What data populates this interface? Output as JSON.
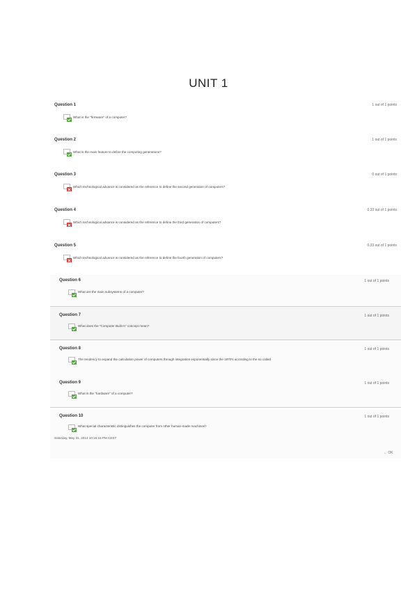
{
  "page": {
    "title": "UNIT 1"
  },
  "questions": [
    {
      "heading": "Question 1",
      "points": "1 out of 1 points",
      "status": "correct",
      "text": "What is the \"firmware\" of a computer?"
    },
    {
      "heading": "Question 2",
      "points": "1 out of 1 points",
      "status": "correct",
      "text": "What is the main feature to define the computing generations?"
    },
    {
      "heading": "Question 3",
      "points": "0 out of 1 points",
      "status": "incorrect",
      "text": "Which technological advance is considered as the reference to define the second generation of computers?"
    },
    {
      "heading": "Question 4",
      "points": "0.33 out of 1 points",
      "status": "incorrect",
      "text": "Which technological advance is considered as the reference to define the third generation of computers?"
    },
    {
      "heading": "Question 5",
      "points": "0.33 out of 1 points",
      "status": "incorrect",
      "text": "Which technological advance is considered as the reference to define the fourth generation of computers?"
    },
    {
      "heading": "Question 6",
      "points": "1 out of 1 points",
      "status": "correct",
      "text": "What are the main subsystems of a computer?"
    },
    {
      "heading": "Question 7",
      "points": "1 out of 1 points",
      "status": "correct",
      "text": "What does the \"Computer Built In\" concept mean?"
    },
    {
      "heading": "Question 8",
      "points": "1 out of 1 points",
      "status": "correct",
      "text": "The tendency to expand the calculation power of computers through integration exponentially since the 1970's according to the so called"
    },
    {
      "heading": "Question 9",
      "points": "1 out of 1 points",
      "status": "correct",
      "text": "What is the \"hardware\" of a computer?"
    },
    {
      "heading": "Question 10",
      "points": "1 out of 1 points",
      "status": "correct",
      "text": "What special characteristic distinguishes the computer from other human-made machines?"
    }
  ],
  "footer": {
    "date": "Saturday, May 31, 2014 10:15:15 PM CEST",
    "ok_label": "← OK"
  },
  "colors": {
    "correct": "#52a83c",
    "incorrect": "#d32f2f"
  }
}
